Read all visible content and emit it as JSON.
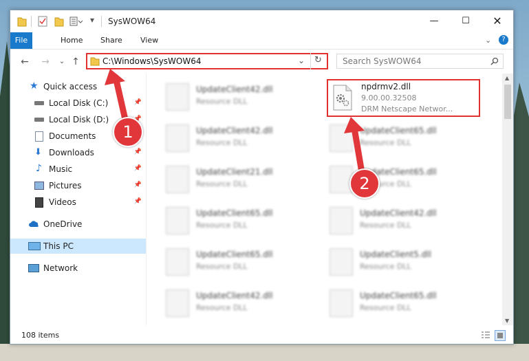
{
  "window": {
    "title": "SysWOW64"
  },
  "ribbon": {
    "tabs": [
      "File",
      "Home",
      "Share",
      "View"
    ]
  },
  "address": {
    "path": "C:\\Windows\\SysWOW64",
    "search_placeholder": "Search SysWOW64"
  },
  "sidebar": {
    "items": [
      {
        "label": "Quick access"
      },
      {
        "label": "Local Disk (C:)"
      },
      {
        "label": "Local Disk (D:)"
      },
      {
        "label": "Documents"
      },
      {
        "label": "Downloads"
      },
      {
        "label": "Music"
      },
      {
        "label": "Pictures"
      },
      {
        "label": "Videos"
      },
      {
        "label": "OneDrive"
      },
      {
        "label": "This PC"
      },
      {
        "label": "Network"
      }
    ]
  },
  "files": [
    {
      "name": "UpdateClient42.dll",
      "type": "Resource DLL"
    },
    {
      "name": "UpdateClient42.dll",
      "type": "Resource DLL"
    },
    {
      "name": "UpdateClient65.dll",
      "type": "Resource DLL"
    },
    {
      "name": "UpdateClient21.dll",
      "type": "Resource DLL"
    },
    {
      "name": "UpdateClient65.dll",
      "type": "Resource DLL"
    },
    {
      "name": "UpdateClient65.dll",
      "type": "Resource DLL"
    },
    {
      "name": "UpdateClient42.dll",
      "type": "Resource DLL"
    },
    {
      "name": "UpdateClient65.dll",
      "type": "Resource DLL"
    },
    {
      "name": "UpdateClient5.dll",
      "type": "Resource DLL"
    },
    {
      "name": "UpdateClient42.dll",
      "type": "Resource DLL"
    },
    {
      "name": "UpdateClient65.dll",
      "type": "Resource DLL"
    }
  ],
  "selected_file": {
    "name": "npdrmv2.dll",
    "version": "9.00.00.32508",
    "description": "DRM Netscape Networ..."
  },
  "status": {
    "items": "108 items"
  },
  "annotations": [
    "1",
    "2"
  ],
  "colors": {
    "highlight": "#e0312f",
    "file_tab": "#1979ca",
    "selection": "#cce8ff"
  }
}
